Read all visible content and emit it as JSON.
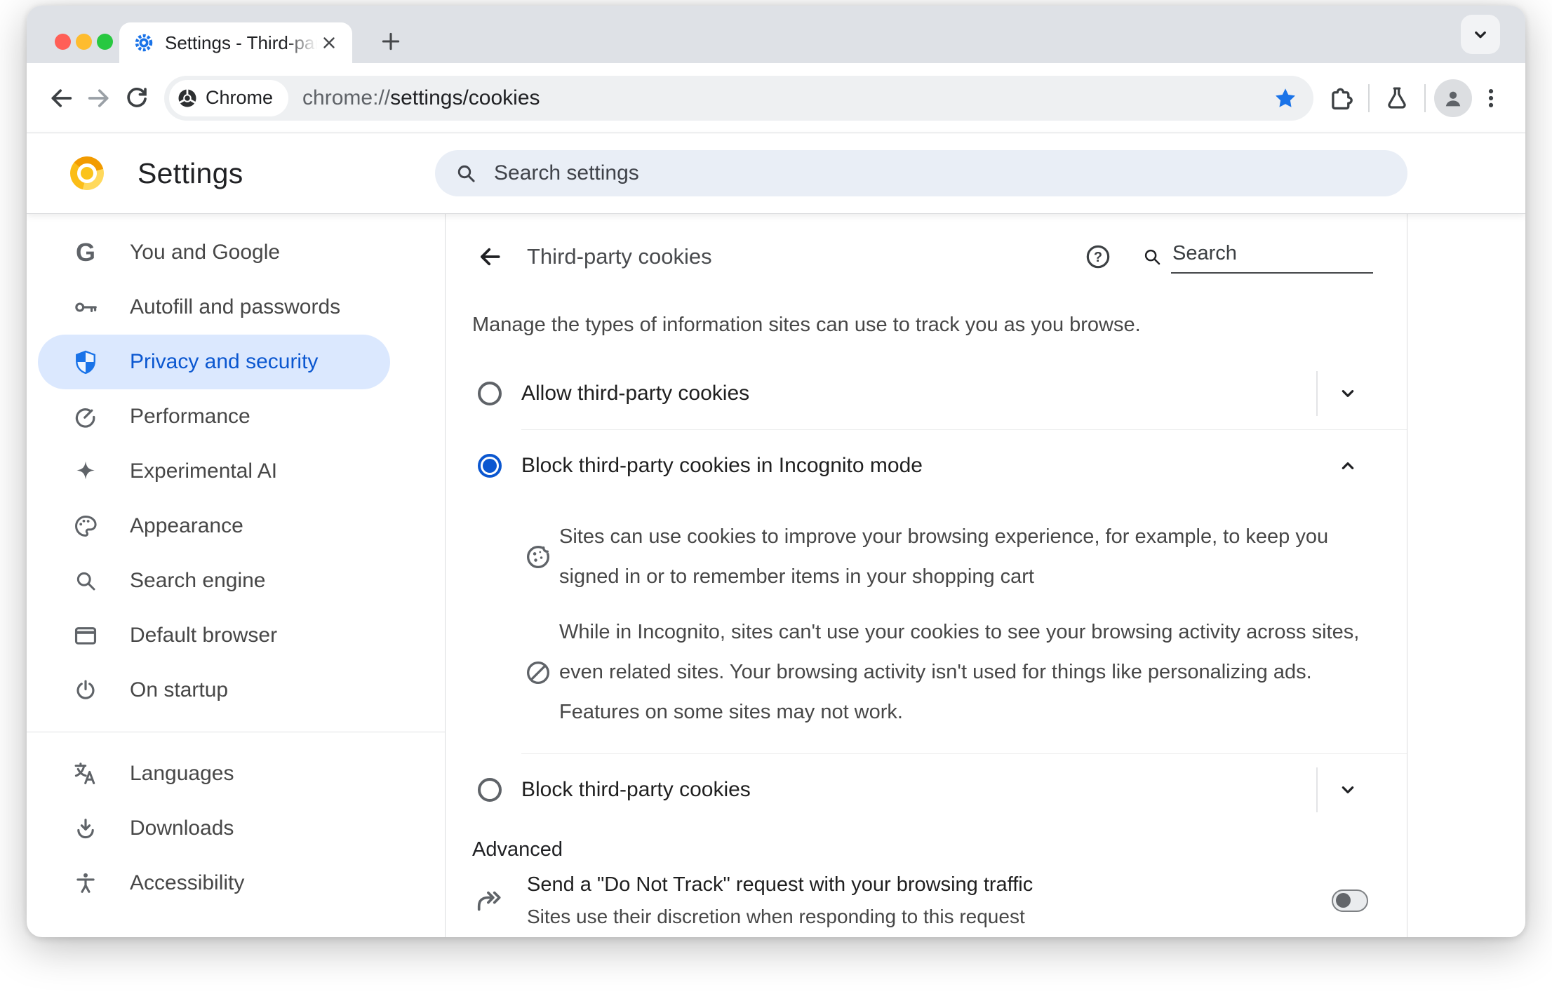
{
  "window": {
    "tab": {
      "title": "Settings - Third-party cookies"
    },
    "tab_search_button": "tab-list-chevron",
    "url_bar": {
      "chip_label": "Chrome",
      "scheme": "chrome://",
      "path": "settings/cookies"
    }
  },
  "settings_header": {
    "title": "Settings",
    "search_placeholder": "Search settings"
  },
  "sidebar": {
    "items": [
      {
        "label": "You and Google",
        "icon": "google-g"
      },
      {
        "label": "Autofill and passwords",
        "icon": "key"
      },
      {
        "label": "Privacy and security",
        "icon": "shield",
        "selected": true
      },
      {
        "label": "Performance",
        "icon": "speedometer"
      },
      {
        "label": "Experimental AI",
        "icon": "sparkle"
      },
      {
        "label": "Appearance",
        "icon": "palette"
      },
      {
        "label": "Search engine",
        "icon": "magnifier"
      },
      {
        "label": "Default browser",
        "icon": "browser-window"
      },
      {
        "label": "On startup",
        "icon": "power"
      },
      {
        "label": "Languages",
        "icon": "translate"
      },
      {
        "label": "Downloads",
        "icon": "download"
      },
      {
        "label": "Accessibility",
        "icon": "accessibility-person"
      }
    ]
  },
  "content": {
    "page_title": "Third-party cookies",
    "search_placeholder": "Search",
    "intro": "Manage the types of information sites can use to track you as you browse.",
    "options": [
      {
        "label": "Allow third-party cookies",
        "selected": false,
        "expanded": false
      },
      {
        "label": "Block third-party cookies in Incognito mode",
        "selected": true,
        "expanded": true
      },
      {
        "label": "Block third-party cookies",
        "selected": false,
        "expanded": false
      }
    ],
    "descriptions": [
      {
        "icon": "cookie",
        "text": "Sites can use cookies to improve your browsing experience, for example, to keep you signed in or to remember items in your shopping cart"
      },
      {
        "icon": "blocked",
        "text": "While in Incognito, sites can't use your cookies to see your browsing activity across sites, even related sites. Your browsing activity isn't used for things like personalizing ads. Features on some sites may not work."
      }
    ],
    "advanced_label": "Advanced",
    "do_not_track": {
      "title": "Send a \"Do Not Track\" request with your browsing traffic",
      "subtitle": "Sites use their discretion when responding to this request",
      "enabled": false
    }
  },
  "colors": {
    "accent_blue": "#0b57d0",
    "bookmark_star_blue": "#1a73e8",
    "selected_nav_bg": "#dbe8fe",
    "traffic_red": "#ff5f57",
    "traffic_yellow": "#febc2e",
    "traffic_green": "#28c840",
    "canary_logo_orange": "#f29b00",
    "canary_logo_yellow": "#fbc31a"
  }
}
